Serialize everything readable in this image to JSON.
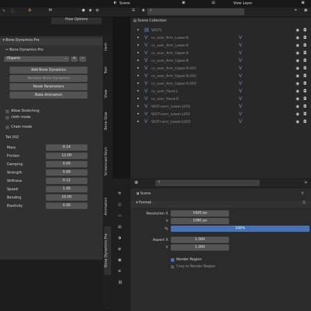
{
  "topbar": {
    "scene_label": "Scene",
    "viewlayer_label": "View Layer"
  },
  "left_toolbar": {
    "mode_icons": [
      "cursor-icon",
      "select-box-icon",
      "view-icon",
      "sphere-solid-icon",
      "sphere-material-icon",
      "sphere-render-icon"
    ],
    "header_label": "Pose Options"
  },
  "addon": {
    "title": "Bone Dynamics Pro",
    "subtitle": "Bone Dynamics Pro",
    "preset": "Organic",
    "add_button": "Add Bone Dynamics",
    "remove_button": "Remove Bone Dynamics",
    "reset_button": "Reset Parameters",
    "bake_button": "Bake Animation",
    "allow_stretching": "Allow Stretching",
    "cloth_mode": "cloth mode",
    "chain_mode": "Chain mode",
    "bone_name": "Tail.002",
    "params": [
      {
        "label": "Mass",
        "value": "0.14"
      },
      {
        "label": "Friction",
        "value": "12.00"
      },
      {
        "label": "Damping",
        "value": "0.00"
      },
      {
        "label": "Strength",
        "value": "0.69"
      },
      {
        "label": "Stiffness",
        "value": "0.12"
      },
      {
        "label": "Speed",
        "value": "1.00"
      },
      {
        "label": "Bending",
        "value": "10.00"
      },
      {
        "label": "Elasticity",
        "value": "0.00"
      }
    ]
  },
  "side_tabs": [
    "Item",
    "Tool",
    "View",
    "Bone Glue",
    "Screencast Keys",
    "Animation",
    "Bone Dynamics Pro"
  ],
  "outliner": {
    "collection": "Scene Collection",
    "rows": [
      "WGTS",
      "cs_user_Arm_Lower.R",
      "cs_user_Arm_Lower.R",
      "cs_user_Arm_Upper.R",
      "cs_user_Arm_Upper.R",
      "cs_user_Arm_Upper.R.001",
      "cs_user_Arm_Upper.R.002",
      "cs_user_Arm_Upper.R.003",
      "cs_user_Hand.L",
      "cs_user_Hand.R",
      "WGT-rarm_Lower.L001",
      "WGT-rarm_Lower.L002",
      "WGT-rarm_Lower.L003"
    ]
  },
  "properties": {
    "scene_label": "Scene",
    "format_label": "Format",
    "resolution_x_label": "Resolution X",
    "resolution_x": "1920 px",
    "y_label": "Y",
    "resolution_y": "1080 px",
    "percent_label": "%",
    "percent": "100%",
    "aspect_x_label": "Aspect X",
    "aspect_x": "1.000",
    "aspect_y_label": "Y",
    "aspect_y": "1.000",
    "render_region": "Render Region",
    "crop_region": "Crop to Render Region"
  },
  "colors": {
    "accent": "#4772b3",
    "bg": "#1d1d1d",
    "panel": "#303030"
  }
}
